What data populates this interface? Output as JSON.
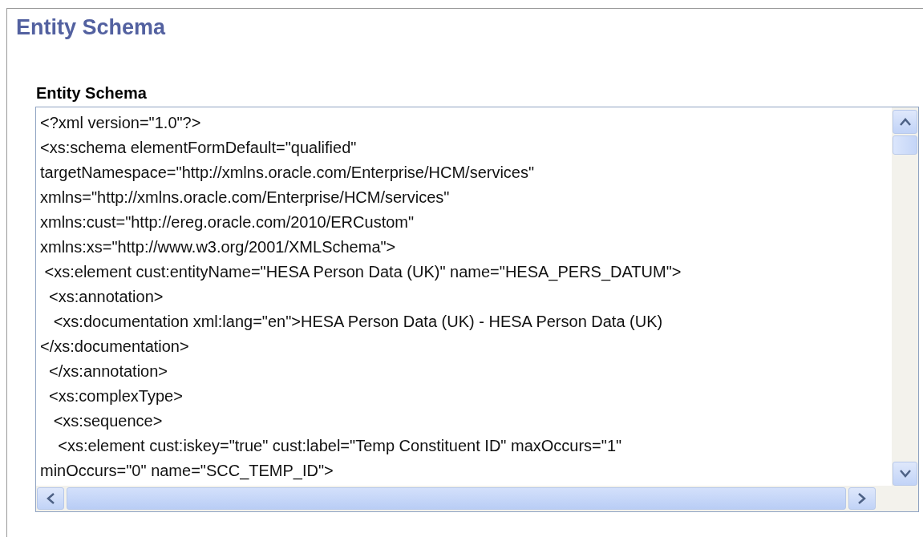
{
  "page": {
    "title": "Entity Schema"
  },
  "schema_field": {
    "label": "Entity Schema",
    "lines": [
      "<?xml version=\"1.0\"?>",
      "<xs:schema elementFormDefault=\"qualified\"",
      "targetNamespace=\"http://xmlns.oracle.com/Enterprise/HCM/services\"",
      "xmlns=\"http://xmlns.oracle.com/Enterprise/HCM/services\"",
      "xmlns:cust=\"http://ereg.oracle.com/2010/ERCustom\"",
      "xmlns:xs=\"http://www.w3.org/2001/XMLSchema\">",
      " <xs:element cust:entityName=\"HESA Person Data (UK)\" name=\"HESA_PERS_DATUM\">",
      "  <xs:annotation>",
      "   <xs:documentation xml:lang=\"en\">HESA Person Data (UK) - HESA Person Data (UK)",
      "</xs:documentation>",
      "  </xs:annotation>",
      "  <xs:complexType>",
      "   <xs:sequence>",
      "    <xs:element cust:iskey=\"true\" cust:label=\"Temp Constituent ID\" maxOccurs=\"1\"",
      "minOccurs=\"0\" name=\"SCC_TEMP_ID\">"
    ]
  }
}
